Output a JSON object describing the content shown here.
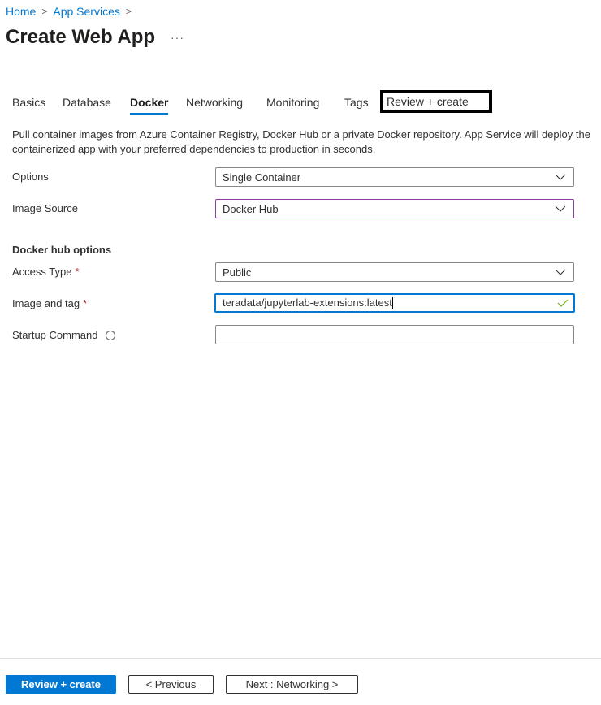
{
  "breadcrumb": [
    {
      "label": "Home"
    },
    {
      "label": "App Services"
    }
  ],
  "breadcrumb_separator": ">",
  "page": {
    "title": "Create Web App",
    "more_label": "···"
  },
  "tabs": [
    {
      "label": "Basics",
      "active": false
    },
    {
      "label": "Database",
      "active": false
    },
    {
      "label": "Docker",
      "active": true
    },
    {
      "label": "Networking",
      "active": false
    },
    {
      "label": "Monitoring",
      "active": false
    },
    {
      "label": "Tags",
      "active": false
    },
    {
      "label": "Review + create",
      "active": false,
      "highlighted": true
    }
  ],
  "description": "Pull container images from Azure Container Registry, Docker Hub or a private Docker repository. App Service will deploy the containerized app with your preferred dependencies to production in seconds.",
  "form": {
    "options": {
      "label": "Options",
      "value": "Single Container",
      "icon": "chevron-down-icon"
    },
    "image_source": {
      "label": "Image Source",
      "value": "Docker Hub",
      "icon": "chevron-down-icon"
    },
    "section_heading": "Docker hub options",
    "access_type": {
      "label": "Access Type",
      "required_mark": "*",
      "value": "Public",
      "icon": "chevron-down-icon"
    },
    "image_and_tag": {
      "label": "Image and tag",
      "required_mark": "*",
      "value": "teradata/jupyterlab-extensions:latest",
      "icon": "checkmark-icon",
      "valid_color": "#6bb700"
    },
    "startup_command": {
      "label": "Startup Command",
      "value": "",
      "icon": "info-icon"
    }
  },
  "footer": {
    "primary_label": "Review + create",
    "previous_label": "< Previous",
    "next_label": "Next : Networking >"
  },
  "colors": {
    "accent": "#0078d4",
    "required": "#a4262c",
    "image_source_border": "#8a3e9e",
    "highlight_box": "#000000"
  }
}
